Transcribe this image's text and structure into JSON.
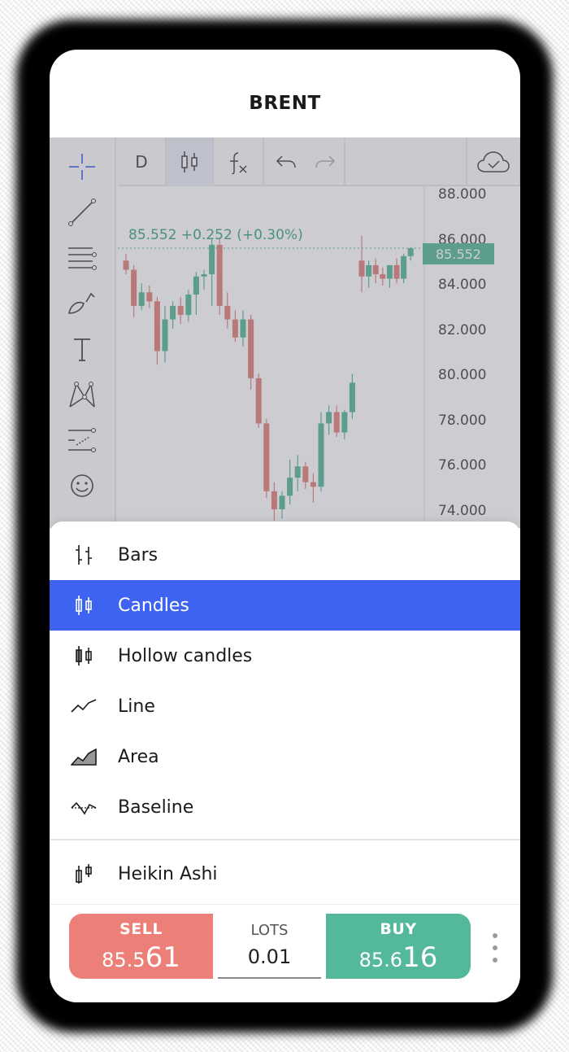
{
  "symbol": "BRENT",
  "toolbar": {
    "interval": "D",
    "chart_type_icon": "candles-icon",
    "indicators_icon": "fx-icon",
    "undo_icon": "undo-icon",
    "redo_icon": "redo-icon",
    "cloud_icon": "cloud-check-icon",
    "fullscreen_icon": "collapse-icon"
  },
  "left_tools": [
    "crosshair-icon",
    "trend-line-icon",
    "fib-icon",
    "brush-icon",
    "text-icon",
    "pattern-icon",
    "prediction-icon",
    "emoji-icon"
  ],
  "legend": {
    "text": "85.552  +0.252 (+0.30%)"
  },
  "price_axis": {
    "ticks": [
      "88.000",
      "86.000",
      "84.000",
      "82.000",
      "80.000",
      "78.000",
      "76.000",
      "74.000"
    ],
    "current_price": "85.552"
  },
  "colors": {
    "up": "#4db38f",
    "down": "#e07a73",
    "selected": "#3d63f0",
    "sell": "#ec8078",
    "buy": "#53b99a"
  },
  "menu": {
    "items": [
      {
        "label": "Bars",
        "icon": "bars-icon",
        "selected": false
      },
      {
        "label": "Candles",
        "icon": "candles-icon",
        "selected": true
      },
      {
        "label": "Hollow candles",
        "icon": "hollow-candles-icon",
        "selected": false
      },
      {
        "label": "Line",
        "icon": "line-icon",
        "selected": false
      },
      {
        "label": "Area",
        "icon": "area-icon",
        "selected": false
      },
      {
        "label": "Baseline",
        "icon": "baseline-icon",
        "selected": false
      }
    ],
    "extra": [
      {
        "label": "Heikin Ashi",
        "icon": "heikin-ashi-icon",
        "selected": false
      }
    ]
  },
  "trade": {
    "sell_label": "SELL",
    "sell_price_small": "85.5",
    "sell_price_big": "61",
    "lots_label": "LOTS",
    "lots_value": "0.01",
    "buy_label": "BUY",
    "buy_price_small": "85.6",
    "buy_price_big": "16"
  }
}
